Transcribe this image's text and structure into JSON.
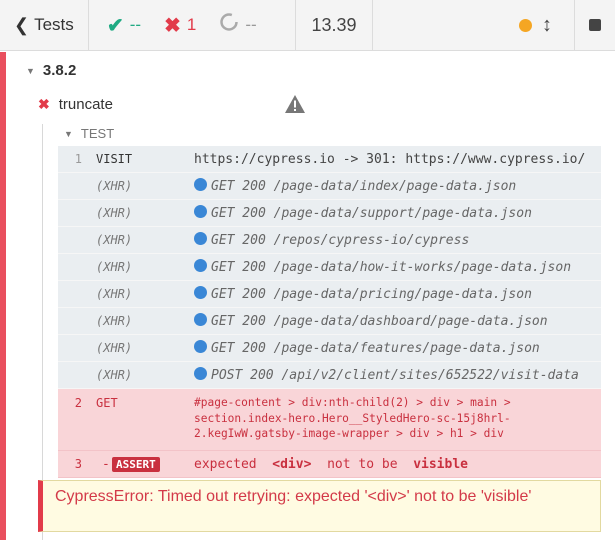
{
  "header": {
    "tests_label": "Tests",
    "passed": "--",
    "failed": "1",
    "pending": "--",
    "duration": "13.39"
  },
  "icons": {
    "back": "chevron-left-icon",
    "passed": "check-icon",
    "failed": "x-icon",
    "pending": "circle-notch-icon",
    "status": "running-dot-icon",
    "scroll": "arrows-vertical-icon",
    "stop": "stop-icon",
    "warning": "warning-triangle-icon"
  },
  "colors": {
    "fail": "#e23b4a",
    "pass": "#1faa83",
    "status_dot": "#f5a623",
    "xhr_dot": "#3a87d6"
  },
  "suite": {
    "title": "3.8.2"
  },
  "test": {
    "title": "truncate",
    "section": "TEST"
  },
  "commands": [
    {
      "num": "1",
      "name": "VISIT",
      "message": "https://cypress.io -> 301: https://www.cypress.io/",
      "kind": "visit"
    },
    {
      "num": "",
      "name": "(XHR)",
      "message": "GET 200 /page-data/index/page-data.json",
      "kind": "xhr"
    },
    {
      "num": "",
      "name": "(XHR)",
      "message": "GET 200 /page-data/support/page-data.json",
      "kind": "xhr"
    },
    {
      "num": "",
      "name": "(XHR)",
      "message": "GET 200 /repos/cypress-io/cypress",
      "kind": "xhr"
    },
    {
      "num": "",
      "name": "(XHR)",
      "message": "GET 200 /page-data/how-it-works/page-data.json",
      "kind": "xhr"
    },
    {
      "num": "",
      "name": "(XHR)",
      "message": "GET 200 /page-data/pricing/page-data.json",
      "kind": "xhr"
    },
    {
      "num": "",
      "name": "(XHR)",
      "message": "GET 200 /page-data/dashboard/page-data.json",
      "kind": "xhr"
    },
    {
      "num": "",
      "name": "(XHR)",
      "message": "GET 200 /page-data/features/page-data.json",
      "kind": "xhr"
    },
    {
      "num": "",
      "name": "(XHR)",
      "message": "POST 200 /api/v2/client/sites/652522/visit-data",
      "kind": "xhr"
    }
  ],
  "get_cmd": {
    "num": "2",
    "name": "GET",
    "selector": "#page-content > div:nth-child(2) > div > main > section.index-hero.Hero__StyledHero-sc-15j8hrl-2.kegIwW.gatsby-image-wrapper > div > h1 > div"
  },
  "assert_cmd": {
    "num": "3",
    "dash": "-",
    "badge": "ASSERT",
    "w1": "expected",
    "w2": "<div>",
    "w3": "not to be",
    "w4": "visible"
  },
  "error": {
    "message": "CypressError: Timed out retrying: expected '<div>' not to be 'visible'"
  }
}
